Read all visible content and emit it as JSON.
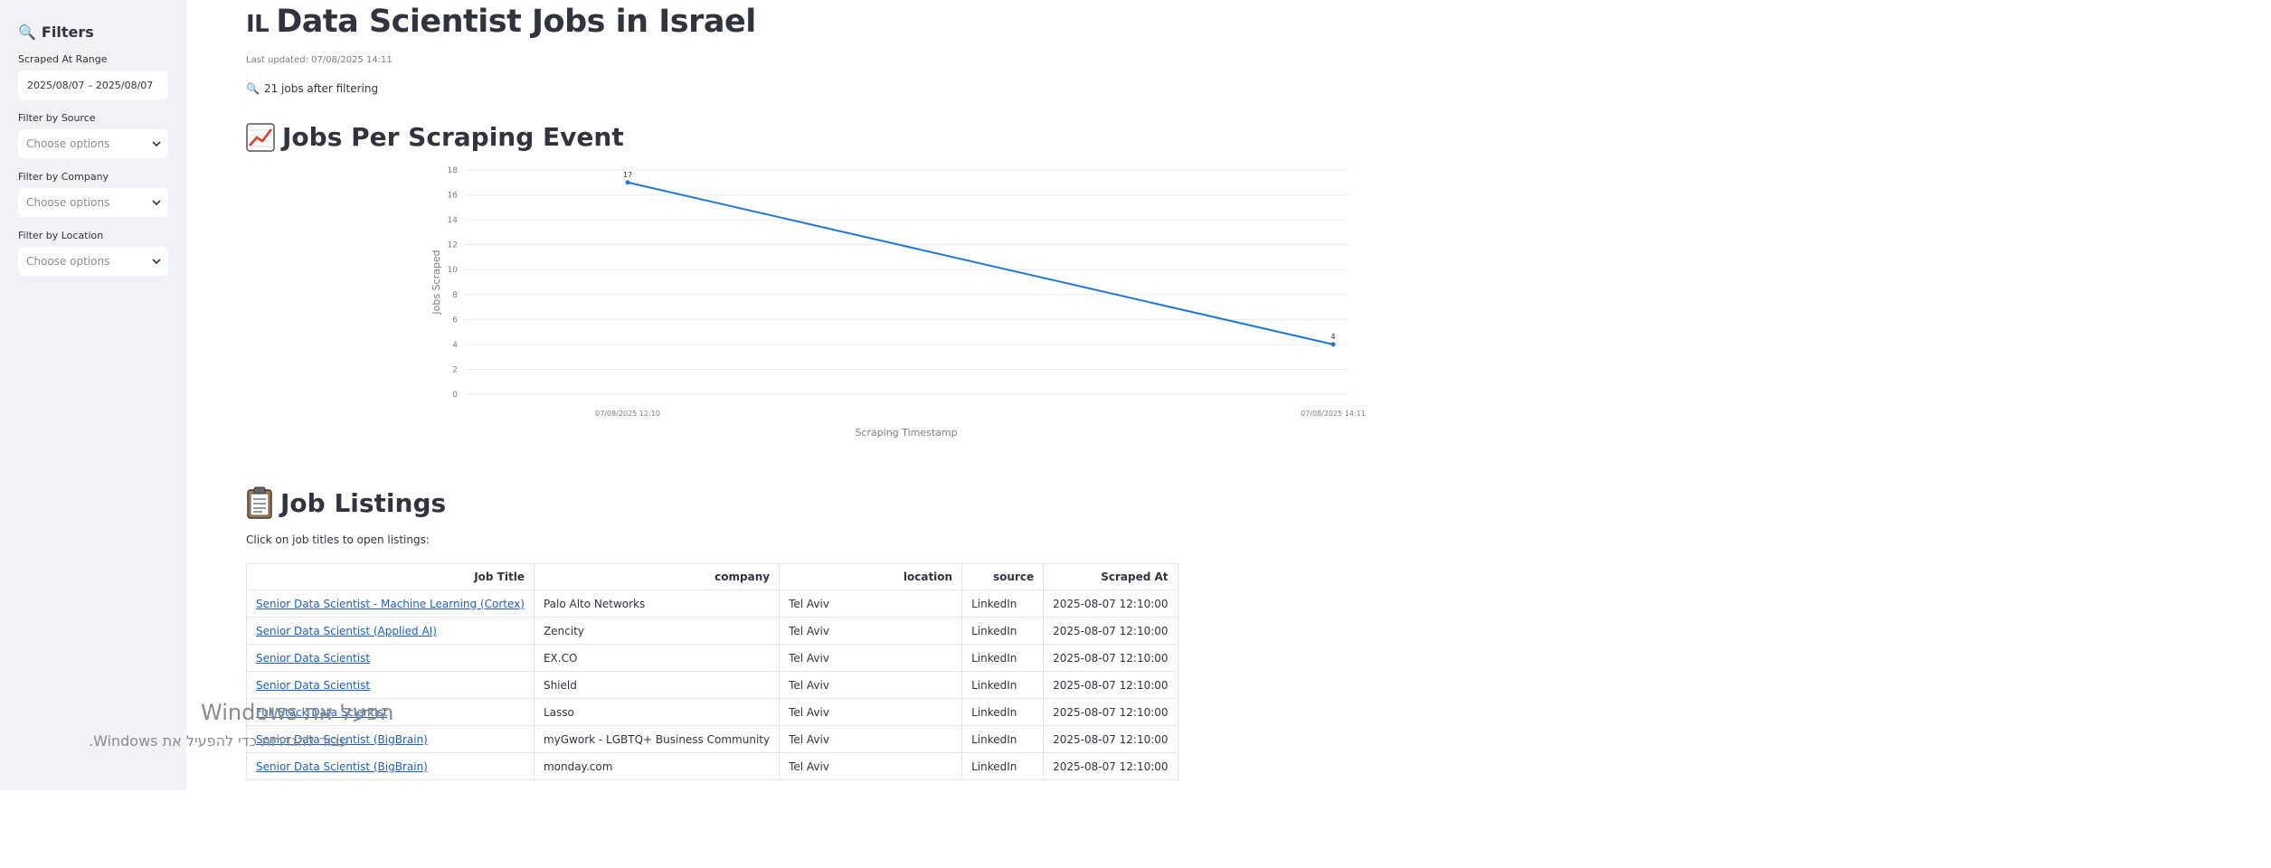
{
  "sidebar": {
    "title": "Filters",
    "date_label": "Scraped At Range",
    "date_value": "2025/08/07 – 2025/08/07",
    "source_label": "Filter by Source",
    "source_placeholder": "Choose options",
    "company_label": "Filter by Company",
    "company_placeholder": "Choose options",
    "location_label": "Filter by Location",
    "location_placeholder": "Choose options"
  },
  "main": {
    "flag": "IL",
    "title": "Data Scientist Jobs in Israel",
    "updated": "Last updated: 07/08/2025 14:11",
    "jobs_count": "21 jobs after filtering",
    "chart_title": "Jobs Per Scraping Event",
    "listings_title": "Job Listings",
    "listings_caption": "Click on job titles to open listings:"
  },
  "chart_data": {
    "type": "line",
    "x": [
      "07/08/2025 12:10",
      "07/08/2025 14:11"
    ],
    "values": [
      17,
      4
    ],
    "data_labels": [
      "17",
      "4"
    ],
    "xlabel": "Scraping Timestamp",
    "ylabel": "Jobs Scraped",
    "ylim": [
      0,
      18
    ],
    "yticks": [
      0,
      2,
      4,
      6,
      8,
      10,
      12,
      14,
      16,
      18
    ],
    "grid": true,
    "color": "#1f77d4"
  },
  "table": {
    "headers": [
      "Job Title",
      "company",
      "location",
      "source",
      "Scraped At"
    ],
    "rows": [
      [
        "Senior Data Scientist - Machine Learning (Cortex)",
        "Palo Alto Networks",
        "Tel Aviv",
        "LinkedIn",
        "2025-08-07 12:10:00"
      ],
      [
        "Senior Data Scientist (Applied AI)",
        "Zencity",
        "Tel Aviv",
        "LinkedIn",
        "2025-08-07 12:10:00"
      ],
      [
        "Senior Data Scientist",
        "EX.CO",
        "Tel Aviv",
        "LinkedIn",
        "2025-08-07 12:10:00"
      ],
      [
        "Senior Data Scientist",
        "Shield",
        "Tel Aviv",
        "LinkedIn",
        "2025-08-07 12:10:00"
      ],
      [
        "Full Stack Data Scientist",
        "Lasso",
        "Tel Aviv",
        "LinkedIn",
        "2025-08-07 12:10:00"
      ],
      [
        "Senior Data Scientist (BigBrain)",
        "myGwork - LGBTQ+ Business Community",
        "Tel Aviv",
        "LinkedIn",
        "2025-08-07 12:10:00"
      ],
      [
        "Senior Data Scientist (BigBrain)",
        "monday.com",
        "Tel Aviv",
        "LinkedIn",
        "2025-08-07 12:10:00"
      ]
    ]
  },
  "watermark": {
    "line1": "הפעל את Windows",
    "line2": "עבור להגדרות כדי להפעיל את Windows."
  },
  "colors": {
    "sidebar_bg": "#f0f2f6",
    "text": "#31333f",
    "link": "#1f5fbf",
    "line": "#1f77d4"
  }
}
